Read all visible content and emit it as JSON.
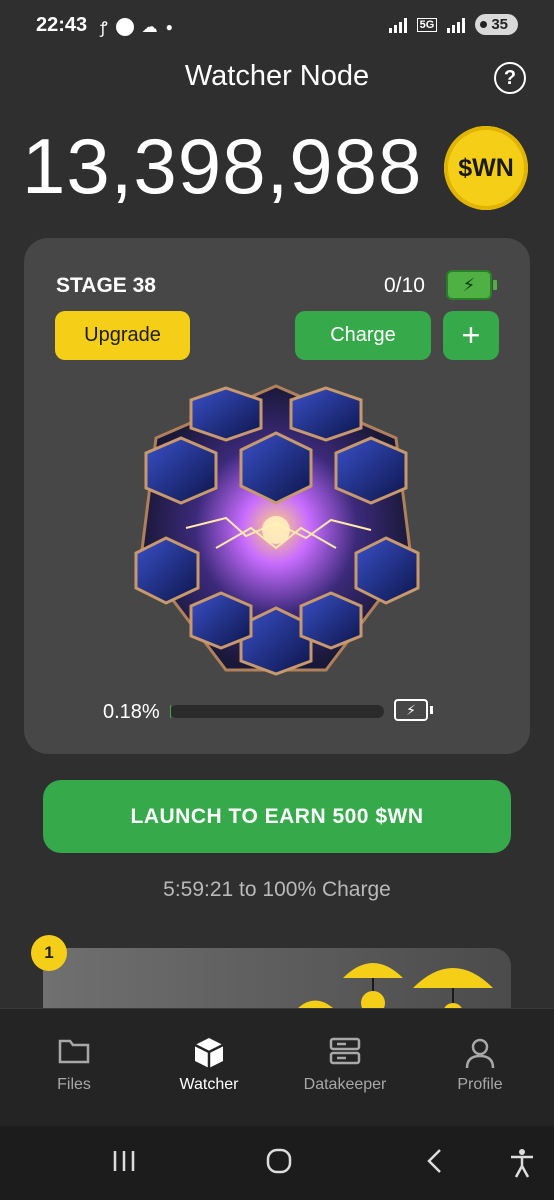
{
  "status_bar": {
    "time": "22:43",
    "network": "5G",
    "battery": "35"
  },
  "header": {
    "title": "Watcher Node",
    "help_label": "?"
  },
  "balance": {
    "amount": "13,398,988",
    "token": "$WN"
  },
  "node": {
    "stage": "STAGE 38",
    "charges": "0/10",
    "upgrade_label": "Upgrade",
    "charge_label": "Charge",
    "add_label": "+",
    "progress_text": "0.18%",
    "progress_value": 0.0018
  },
  "launch": {
    "label": "LAUNCH TO EARN 500 $WN",
    "timer_text": "5:59:21 to 100% Charge"
  },
  "promo": {
    "badge": "1"
  },
  "nav": {
    "items": [
      {
        "label": "Files",
        "icon": "folder-icon"
      },
      {
        "label": "Watcher",
        "icon": "cube-icon"
      },
      {
        "label": "Datakeeper",
        "icon": "server-icon"
      },
      {
        "label": "Profile",
        "icon": "user-icon"
      }
    ],
    "active": "Watcher"
  },
  "colors": {
    "accent_green": "#36a94a",
    "accent_yellow": "#f5cf17",
    "background": "#2f2f2f",
    "card": "#474747"
  }
}
